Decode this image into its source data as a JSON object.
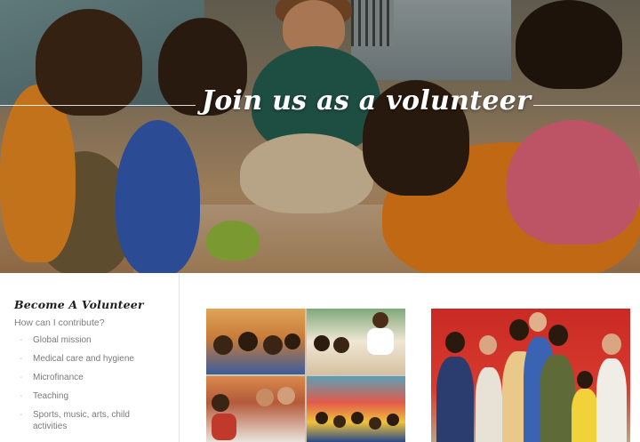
{
  "hero": {
    "title": "Join us as a volunteer"
  },
  "sidebar": {
    "heading": "Become A Volunteer",
    "subheading": "How can I contribute?",
    "items": [
      {
        "label": "Global mission"
      },
      {
        "label": "Medical care and hygiene"
      },
      {
        "label": "Microfinance"
      },
      {
        "label": "Teaching"
      },
      {
        "label": "Sports, music, arts, child activities"
      }
    ]
  },
  "colors": {
    "accent_orange": "#e57a16",
    "text_dark": "#1e1e1e",
    "text_muted": "#7a7a7a"
  }
}
